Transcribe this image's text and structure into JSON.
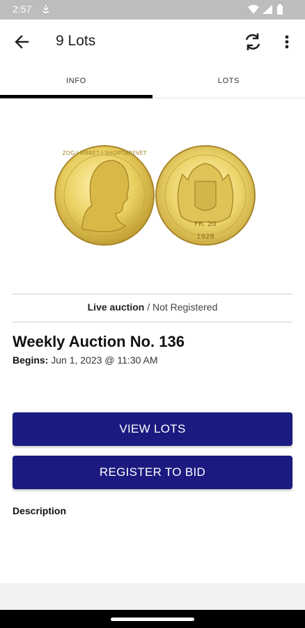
{
  "status_bar": {
    "time": "2:57"
  },
  "app_bar": {
    "title": "9 Lots"
  },
  "tabs": [
    {
      "label": "INFO",
      "selected": true
    },
    {
      "label": "LOTS",
      "selected": false
    }
  ],
  "coins": {
    "front_inscription": "ZOG·I·MBRET·I·SHQIPTAREVET",
    "back_inscription": "FR. 20",
    "back_year": "1928"
  },
  "auction": {
    "type_label": "Live auction",
    "registration_status": "/ Not Registered",
    "title": "Weekly Auction No. 136",
    "begins_label": "Begins:",
    "begins_value": "Jun 1, 2023 @ 11:30 AM"
  },
  "buttons": {
    "view_lots": "VIEW LOTS",
    "register": "REGISTER TO BID"
  },
  "description_label": "Description",
  "colors": {
    "primary_button": "#1a1a80",
    "tab_indicator": "#000000",
    "status_bar": "#bdbdbd"
  }
}
